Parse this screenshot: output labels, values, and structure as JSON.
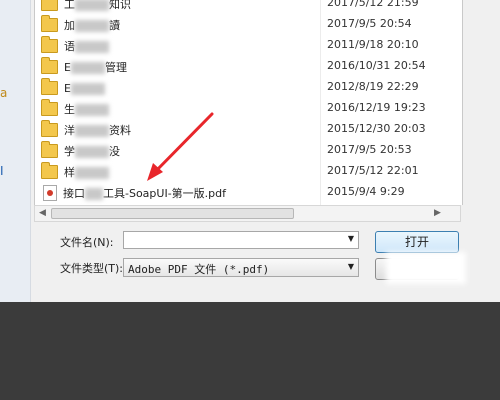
{
  "window": {
    "title": ""
  },
  "files": [
    {
      "type": "folder",
      "name_parts": [
        "工",
        "知识"
      ],
      "blurred": true,
      "date": "2017/5/12 21:59"
    },
    {
      "type": "folder",
      "name_parts": [
        "加",
        "讀"
      ],
      "blurred": true,
      "date": "2017/9/5 20:54"
    },
    {
      "type": "folder",
      "name_parts": [
        "语",
        ""
      ],
      "blurred": true,
      "date": "2011/9/18 20:10"
    },
    {
      "type": "folder",
      "name_parts": [
        "E",
        "管理"
      ],
      "blurred": true,
      "date": "2016/10/31 20:54"
    },
    {
      "type": "folder",
      "name_parts": [
        "E",
        ""
      ],
      "blurred": true,
      "date": "2012/8/19 22:29"
    },
    {
      "type": "folder",
      "name_parts": [
        "生",
        ""
      ],
      "blurred": true,
      "date": "2016/12/19 19:23"
    },
    {
      "type": "folder",
      "name_parts": [
        "洋",
        "资料"
      ],
      "blurred": true,
      "date": "2015/12/30 20:03"
    },
    {
      "type": "folder",
      "name_parts": [
        "学",
        "没"
      ],
      "blurred": true,
      "date": "2017/9/5 20:53"
    },
    {
      "type": "folder",
      "name_parts": [
        "样",
        ""
      ],
      "blurred": true,
      "date": "2017/5/12 22:01"
    },
    {
      "type": "pdf",
      "name_parts": [
        "接口",
        "工具-SoapUI-第一版.pdf"
      ],
      "blurred": true,
      "date": "2015/9/4 9:29"
    }
  ],
  "filename": {
    "label": "文件名(N):",
    "value": ""
  },
  "filetype": {
    "label": "文件类型(T):",
    "selected": "Adobe PDF 文件 (*.pdf)"
  },
  "buttons": {
    "open": "打开"
  },
  "left_pane": {
    "marks": [
      "a",
      "I"
    ]
  },
  "icons": {
    "folder": "folder-icon",
    "pdf": "pdf-file-icon",
    "dropdown": "chevron-down-icon",
    "annotation": "red-arrow-annotation"
  },
  "colors": {
    "annotation": "#e8262b",
    "open_button_border": "#3c7fb1",
    "outer_background": "#3b3b3b"
  }
}
